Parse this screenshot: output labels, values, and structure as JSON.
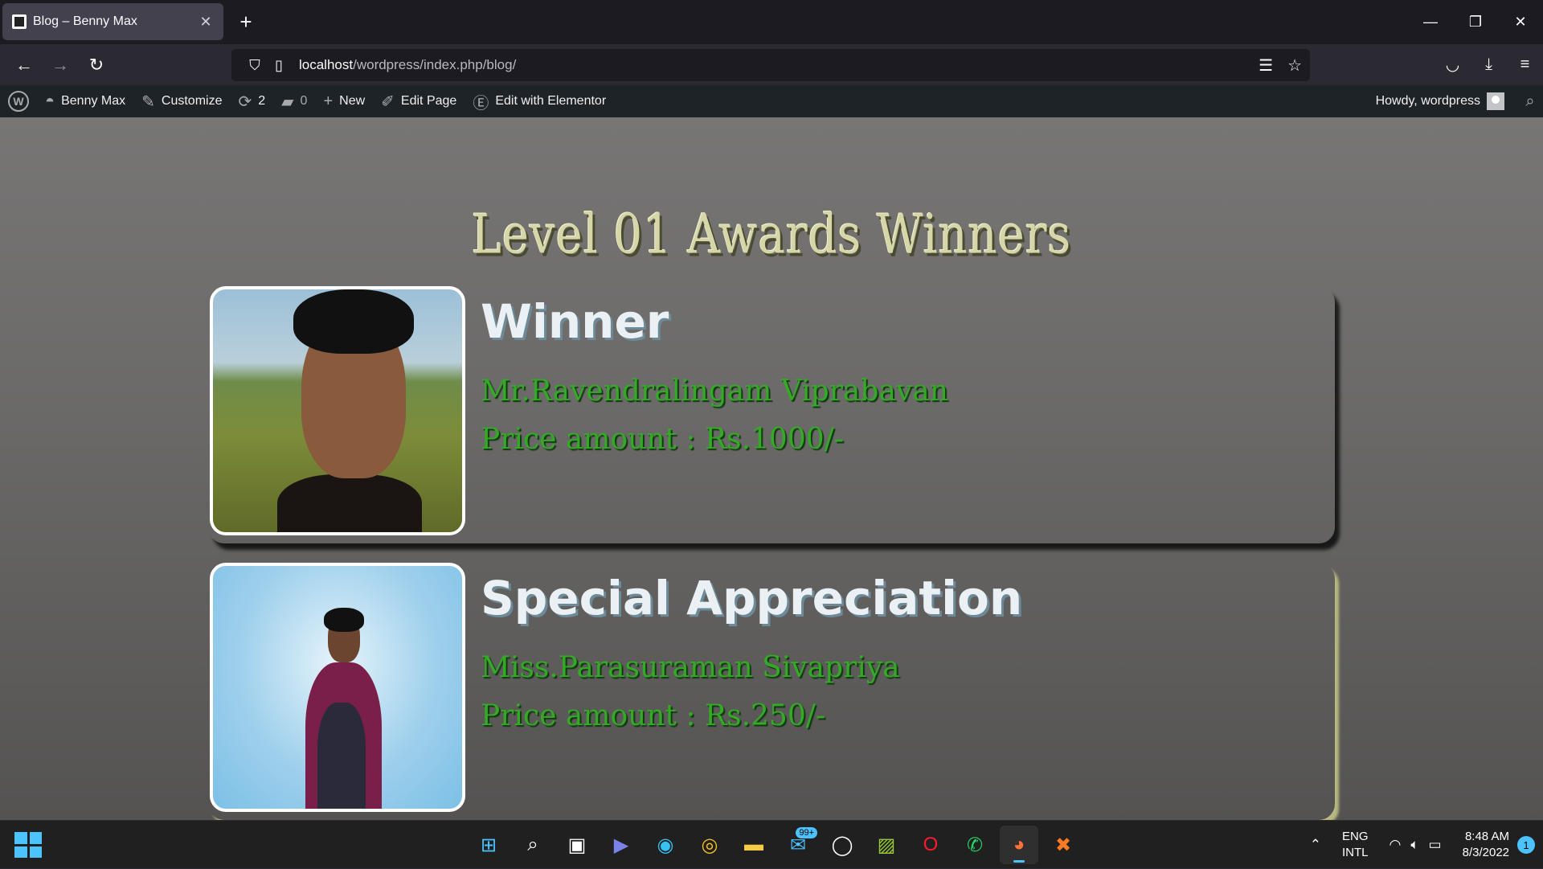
{
  "browser": {
    "tab_title": "Blog – Benny Max",
    "tab_close": "✕",
    "new_tab": "+",
    "url_host": "localhost",
    "url_path": "/wordpress/index.php/blog/",
    "window_controls": {
      "minimize": "—",
      "restore": "❐",
      "close": "✕"
    }
  },
  "wp_admin_bar": {
    "site_name": "Benny Max",
    "customize": "Customize",
    "updates_count": "2",
    "comments_count": "0",
    "new": "New",
    "edit_page": "Edit Page",
    "edit_elementor": "Edit with Elementor",
    "howdy": "Howdy, wordpress"
  },
  "page": {
    "title": "Level 01 Awards Winners",
    "cards": [
      {
        "heading": "Winner",
        "name": "Mr.Ravendralingam Viprabavan",
        "price": "Price amount : Rs.1000/-"
      },
      {
        "heading": "Special Appreciation",
        "name": "Miss.Parasuraman Sivapriya",
        "price": "Price amount : Rs.250/-"
      }
    ]
  },
  "taskbar": {
    "mail_badge": "99+",
    "lang_line1": "ENG",
    "lang_line2": "INTL",
    "time": "8:48 AM",
    "date": "8/3/2022",
    "notifications": "1"
  },
  "colors": {
    "award_title": "#d6d6a8",
    "card_heading": "#eaf0f4",
    "name_green": "#35a828",
    "wp_bar": "#1d2327",
    "accent": "#4cc2ff"
  }
}
